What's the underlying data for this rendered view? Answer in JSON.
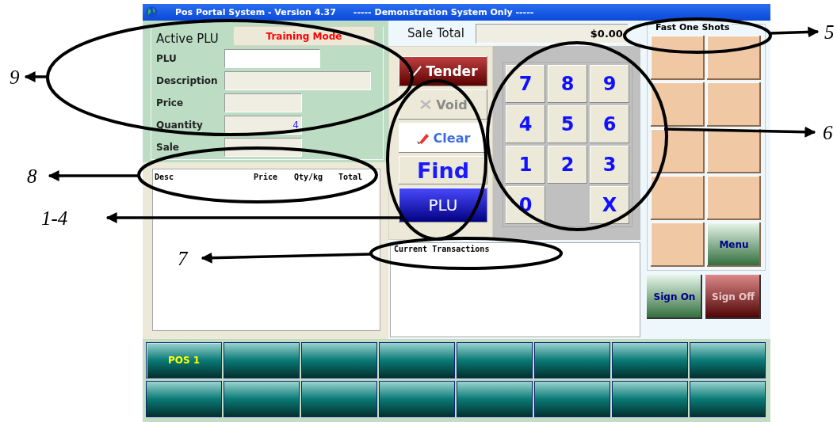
{
  "window": {
    "title": "Pos Portal  System - Version 4.37",
    "subtitle": "----- Demonstration System Only -----"
  },
  "active_plu": {
    "title": "Active PLU",
    "mode_badge": "Training Mode",
    "fields": [
      {
        "label": "PLU",
        "kind": "input"
      },
      {
        "label": "Description",
        "kind": "wide"
      },
      {
        "label": "Price",
        "kind": "short"
      },
      {
        "label": "Quantity",
        "kind": "short",
        "value": "4"
      },
      {
        "label": "Sale",
        "kind": "short"
      }
    ]
  },
  "item_list": {
    "columns": [
      "Desc",
      "Price",
      "Qty/kg",
      "Total"
    ]
  },
  "sale_total": {
    "label": "Sale Total",
    "value": "$0.00"
  },
  "actions": [
    {
      "label": "Tender",
      "kind": "tender",
      "disabled": false
    },
    {
      "label": "Void",
      "kind": "void",
      "disabled": true
    },
    {
      "label": "Clear",
      "kind": "clear",
      "disabled": false
    },
    {
      "label": "Find",
      "kind": "find",
      "disabled": false
    },
    {
      "label": "PLU",
      "kind": "plu",
      "disabled": false
    }
  ],
  "keypad": [
    {
      "kind": "key",
      "label": "7"
    },
    {
      "kind": "key",
      "label": "8"
    },
    {
      "kind": "key",
      "label": "9"
    },
    {
      "kind": "key",
      "label": "4"
    },
    {
      "kind": "key",
      "label": "5"
    },
    {
      "kind": "key",
      "label": "6"
    },
    {
      "kind": "key",
      "label": "1"
    },
    {
      "kind": "key",
      "label": "2"
    },
    {
      "kind": "key",
      "label": "3"
    },
    {
      "kind": "key",
      "label": "0"
    },
    {
      "kind": "gap"
    },
    {
      "kind": "key",
      "label": "X"
    }
  ],
  "transactions": {
    "title": "Current Transactions"
  },
  "fast_one_shots": {
    "title": "Fast One Shots",
    "buttons": [
      {
        "kind": "empty"
      },
      {
        "kind": "empty"
      },
      {
        "kind": "empty"
      },
      {
        "kind": "empty"
      },
      {
        "kind": "empty"
      },
      {
        "kind": "empty"
      },
      {
        "kind": "empty"
      },
      {
        "kind": "empty"
      },
      {
        "kind": "empty"
      },
      {
        "kind": "menu",
        "label": "Menu"
      }
    ]
  },
  "sign_buttons": [
    {
      "kind": "sign_on",
      "label": "Sign On"
    },
    {
      "kind": "sign_off",
      "label": "Sign Off"
    }
  ],
  "stations": [
    {
      "kind": "station",
      "label": "POS 1"
    },
    {
      "kind": "blank"
    },
    {
      "kind": "blank"
    },
    {
      "kind": "blank"
    },
    {
      "kind": "blank"
    },
    {
      "kind": "blank"
    },
    {
      "kind": "blank"
    },
    {
      "kind": "blank"
    },
    {
      "kind": "blank"
    },
    {
      "kind": "blank"
    },
    {
      "kind": "blank"
    },
    {
      "kind": "blank"
    },
    {
      "kind": "blank"
    },
    {
      "kind": "blank"
    },
    {
      "kind": "blank"
    },
    {
      "kind": "blank"
    }
  ],
  "annotations": [
    {
      "label": "9"
    },
    {
      "label": "8"
    },
    {
      "label": "1-4"
    },
    {
      "label": "7"
    },
    {
      "label": "6"
    },
    {
      "label": "5"
    }
  ]
}
